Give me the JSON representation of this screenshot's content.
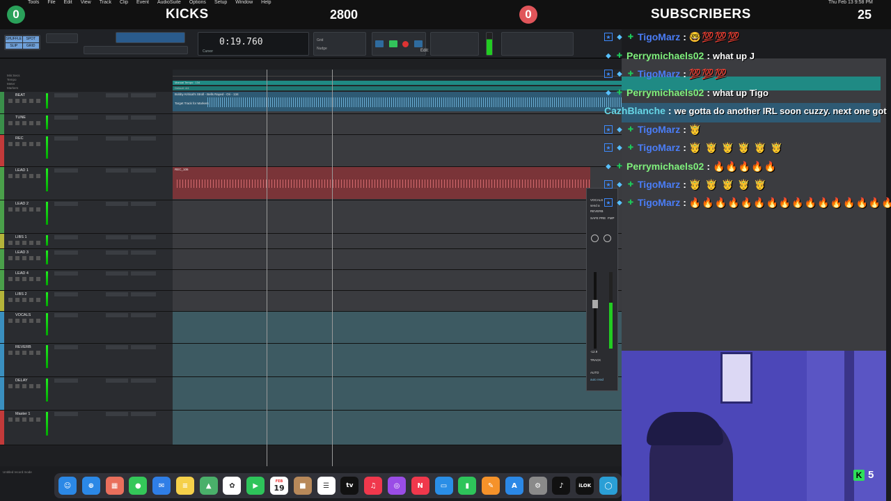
{
  "mac_menu": [
    "Tools",
    "File",
    "Edit",
    "View",
    "Track",
    "Clip",
    "Event",
    "AudioSuite",
    "Options",
    "Setup",
    "Window",
    "Help"
  ],
  "mac_clock": "Thu Feb 13 9:58 PM",
  "overlay": {
    "kicks_count_left": "0",
    "kicks_label": "KICKS",
    "kicks_value": "2800",
    "subs_count_left": "0",
    "subs_label": "SUBSCRIBERS",
    "subs_value": "25"
  },
  "protools": {
    "edit_title": "Edit: new chase 2666",
    "counter": "0:19.760",
    "counter_sub_label": "Cursor",
    "grid_label": "Grid",
    "nudge_label": "Nudge",
    "mode_buttons": [
      "SHUFFLE",
      "SPOT",
      "SLIP",
      "GRID"
    ],
    "ruler_labels": [
      "Min:Secs",
      "Tempo",
      "Meter",
      "Markers"
    ],
    "ruler_tempo": "Manual Tempo : 134",
    "ruler_meter": "Default: 4/4",
    "column_headers": [
      "INSERTS A-E",
      "INSERTS F-J",
      "SENDS A-E",
      "I/O"
    ],
    "tracks": [
      {
        "name": "BEAT",
        "color": "#3a8f4a"
      },
      {
        "name": "TUNE",
        "color": "#3a8f4a"
      },
      {
        "name": "REC",
        "color": "#c23a3a"
      },
      {
        "name": "LEAD 1",
        "color": "#4aa04a"
      },
      {
        "name": "LEAD 2",
        "color": "#4aa04a"
      },
      {
        "name": "LIBS 1",
        "color": "#b4b43a"
      },
      {
        "name": "LEAD 3",
        "color": "#4aa04a"
      },
      {
        "name": "LEAD 4",
        "color": "#4aa04a"
      },
      {
        "name": "LIBS 2",
        "color": "#b4b43a"
      },
      {
        "name": "VOCALS",
        "color": "#3a8fbf"
      },
      {
        "name": "REVERB",
        "color": "#3a8fbf"
      },
      {
        "name": "DELAY",
        "color": "#3a8fbf"
      },
      {
        "name": "Master 1",
        "color": "#c23a3a"
      }
    ],
    "beat_clip_name": "Bobby Kritical's Stroll - Bells Rayed - Ori - 134",
    "rec_clip_name": "REC_106",
    "marker_tooltip": "Target Track for Markers",
    "plugin": {
      "labels": [
        "VOCALS",
        "send a",
        "REVERB",
        "SAFE",
        "PRE",
        "FMP"
      ],
      "track_label": "TRACK",
      "auto_label": "AUTO",
      "auto_value": "auto read",
      "fader_value": "-12.9"
    },
    "status": "Untitled record mode"
  },
  "chat": [
    {
      "user": "TigoMarz",
      "color": "blue",
      "badges": [
        "prime",
        "mod",
        "vip"
      ],
      "msg": "🤓💯💯💯"
    },
    {
      "user": "Perrymichaels02",
      "color": "green",
      "badges": [
        "mod",
        "vip"
      ],
      "msg": "what up J"
    },
    {
      "user": "TigoMarz",
      "color": "blue",
      "badges": [
        "prime",
        "mod",
        "vip"
      ],
      "msg": "💯💯💯"
    },
    {
      "user": "Perrymichaels02",
      "color": "green",
      "badges": [
        "mod",
        "vip"
      ],
      "msg": "what up Tigo"
    },
    {
      "user": "CazhBlanche",
      "color": "cyan",
      "badges": [],
      "msg": "we gotta do another IRL soon cuzzy. next one got"
    },
    {
      "user": "TigoMarz",
      "color": "blue",
      "badges": [
        "prime",
        "mod",
        "vip"
      ],
      "msg": "🤴"
    },
    {
      "user": "TigoMarz",
      "color": "blue",
      "badges": [
        "prime",
        "mod",
        "vip"
      ],
      "msg": "🤴 🤴 🤴 🤴 🤴 🤴"
    },
    {
      "user": "Perrymichaels02",
      "color": "green",
      "badges": [
        "mod",
        "vip"
      ],
      "msg": "🔥🔥🔥🔥🔥"
    },
    {
      "user": "TigoMarz",
      "color": "blue",
      "badges": [
        "prime",
        "mod",
        "vip"
      ],
      "msg": "🤴 🤴 🤴 🤴 🤴"
    },
    {
      "user": "TigoMarz",
      "color": "blue",
      "badges": [
        "prime",
        "mod",
        "vip"
      ],
      "msg": "🔥🔥🔥🔥🔥🔥🔥🔥🔥🔥🔥🔥🔥🔥🔥🔥"
    }
  ],
  "kick_viewers": "5",
  "dock": [
    {
      "name": "finder",
      "glyph": "☺",
      "color": "#2b88e6"
    },
    {
      "name": "safari",
      "glyph": "⊕",
      "color": "#2b88e6"
    },
    {
      "name": "launchpad",
      "glyph": "▦",
      "color": "#e96f5c"
    },
    {
      "name": "messages",
      "glyph": "●",
      "color": "#34c759"
    },
    {
      "name": "mail",
      "glyph": "✉",
      "color": "#2f7ee6"
    },
    {
      "name": "notes",
      "glyph": "≡",
      "color": "#f5d04a"
    },
    {
      "name": "maps",
      "glyph": "▲",
      "color": "#4ab06a"
    },
    {
      "name": "photos",
      "glyph": "✿",
      "color": "#ffffff"
    },
    {
      "name": "facetime",
      "glyph": "▶",
      "color": "#2ec45a"
    },
    {
      "name": "calendar",
      "glyph": "19",
      "color": "#ffffff"
    },
    {
      "name": "box",
      "glyph": "■",
      "color": "#b8895a"
    },
    {
      "name": "reminders",
      "glyph": "☰",
      "color": "#ffffff"
    },
    {
      "name": "tv",
      "glyph": "tv",
      "color": "#111111"
    },
    {
      "name": "music",
      "glyph": "♫",
      "color": "#f0384c"
    },
    {
      "name": "podcasts",
      "glyph": "◎",
      "color": "#9a4de6"
    },
    {
      "name": "news",
      "glyph": "N",
      "color": "#f0384c"
    },
    {
      "name": "keynote",
      "glyph": "▭",
      "color": "#2a8ee6"
    },
    {
      "name": "numbers",
      "glyph": "▮",
      "color": "#2ec45a"
    },
    {
      "name": "pages",
      "glyph": "✎",
      "color": "#f5922a"
    },
    {
      "name": "app-store",
      "glyph": "A",
      "color": "#2b88e6"
    },
    {
      "name": "system-settings",
      "glyph": "⚙",
      "color": "#8a8a8a"
    },
    {
      "name": "pro-tools",
      "glyph": "♪",
      "color": "#111111"
    },
    {
      "name": "ilok",
      "glyph": "iLOK",
      "color": "#111111"
    },
    {
      "name": "obs",
      "glyph": "◯",
      "color": "#2a9fd6"
    }
  ],
  "calendar_month": "FEB",
  "calendar_day": "19"
}
